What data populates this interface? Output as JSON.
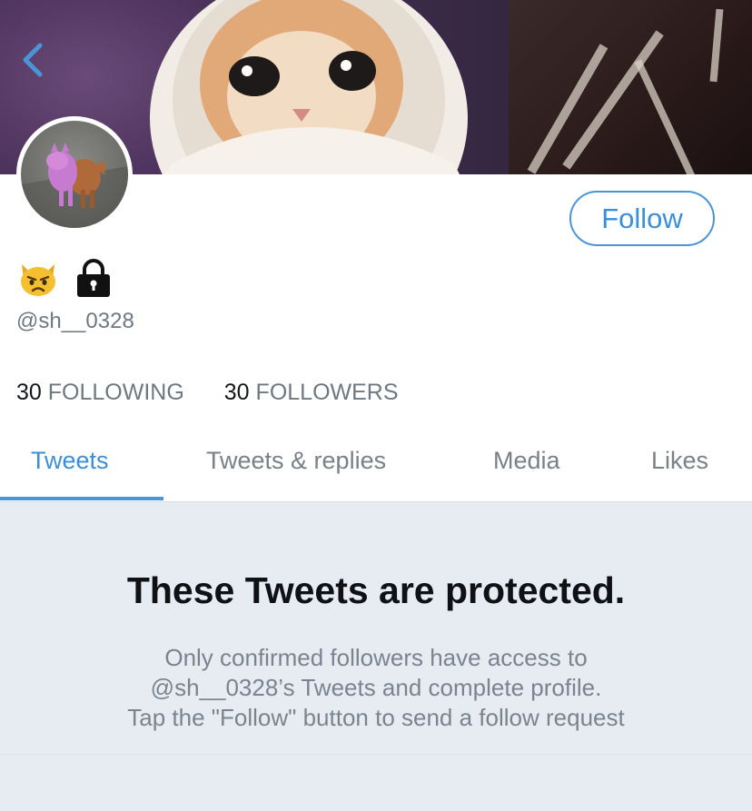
{
  "header": {
    "back_icon": "chevron-left-icon",
    "banner_image": "crying-cat-in-towel"
  },
  "profile": {
    "avatar_image": "pink-dog-photo",
    "name_icons": [
      "pouting-cat-emoji",
      "lock-icon"
    ],
    "handle": "@sh__0328",
    "follow_label": "Follow",
    "following_count": "30",
    "following_label": "FOLLOWING",
    "followers_count": "30",
    "followers_label": "FOLLOWERS"
  },
  "tabs": [
    {
      "label": "Tweets",
      "active": true
    },
    {
      "label": "Tweets & replies",
      "active": false
    },
    {
      "label": "Media",
      "active": false
    },
    {
      "label": "Likes",
      "active": false
    }
  ],
  "protected": {
    "title": "These Tweets are protected.",
    "lines": [
      "Only confirmed followers have access to",
      "@sh__0328’s Tweets and complete profile.",
      "Tap the \"Follow\" button to send a follow request"
    ]
  },
  "colors": {
    "accent": "#4a95d6",
    "panel_bg": "#e6ecf2",
    "secondary_text": "#6f7880"
  }
}
